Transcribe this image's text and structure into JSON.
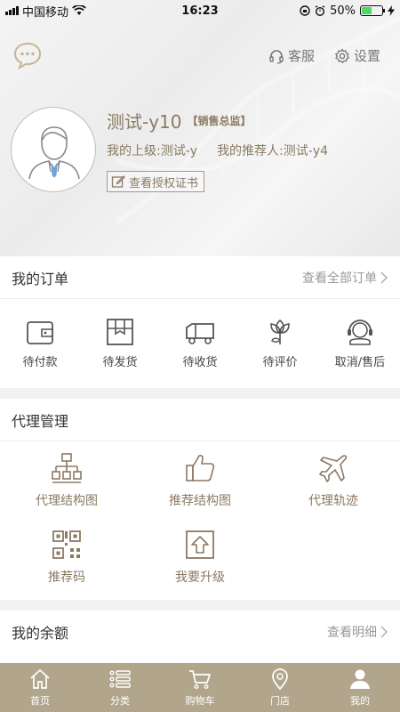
{
  "status_bar": {
    "carrier": "中国移动",
    "time": "16:23",
    "battery": "50%",
    "battery_level": 0.5
  },
  "header": {
    "service_label": "客服",
    "settings_label": "设置",
    "user_name": "测试-y10",
    "user_role": "【销售总监】",
    "superior_text": "我的上级:测试-y",
    "referrer_text": "我的推荐人:测试-y4",
    "certificate_label": "查看授权证书"
  },
  "orders": {
    "title": "我的订单",
    "more_label": "查看全部订单",
    "items": [
      {
        "label": "待付款",
        "icon": "wallet-icon"
      },
      {
        "label": "待发货",
        "icon": "package-icon"
      },
      {
        "label": "待收货",
        "icon": "truck-icon"
      },
      {
        "label": "待评价",
        "icon": "flower-icon"
      },
      {
        "label": "取消/售后",
        "icon": "headset-icon"
      }
    ]
  },
  "agent": {
    "title": "代理管理",
    "items": [
      {
        "label": "代理结构图",
        "icon": "org-chart-icon"
      },
      {
        "label": "推荐结构图",
        "icon": "thumbs-up-icon"
      },
      {
        "label": "代理轨迹",
        "icon": "airplane-icon"
      },
      {
        "label": "推荐码",
        "icon": "qr-code-icon"
      },
      {
        "label": "我要升级",
        "icon": "upgrade-icon"
      }
    ]
  },
  "balance": {
    "title": "我的余额",
    "more_label": "查看明细"
  },
  "tabbar": {
    "items": [
      {
        "label": "首页",
        "icon": "home-icon"
      },
      {
        "label": "分类",
        "icon": "category-icon"
      },
      {
        "label": "购物车",
        "icon": "cart-icon"
      },
      {
        "label": "门店",
        "icon": "location-icon"
      },
      {
        "label": "我的",
        "icon": "user-icon"
      }
    ],
    "active_index": 4
  },
  "colors": {
    "accent": "#8a7a62",
    "tabbar": "#b1a68c",
    "background": "#f2f2f4"
  }
}
